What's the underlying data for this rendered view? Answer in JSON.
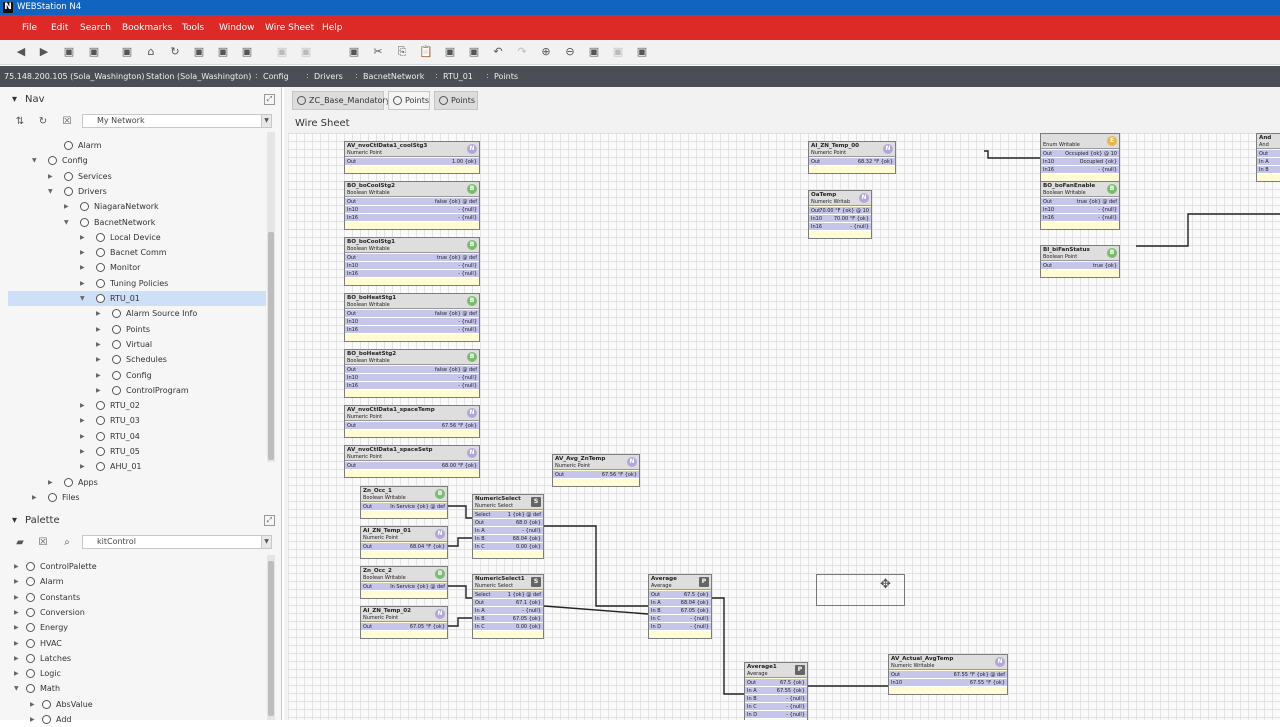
{
  "app": {
    "icon": "N",
    "title": "WEBStation N4"
  },
  "menu": [
    "File",
    "Edit",
    "Search",
    "Bookmarks",
    "Tools",
    "Window",
    "Wire Sheet",
    "Help"
  ],
  "toolbar": {
    "icons": [
      "back-icon",
      "forward-icon",
      "home-icon",
      "refresh-icon",
      "copy-icon",
      "cut-icon",
      "paste-icon",
      "undo-icon",
      "redo-icon",
      "zoom-in-icon",
      "zoom-out-icon"
    ]
  },
  "path": [
    "75.148.200.105 (Sola_Washington)",
    "Station (Sola_Washington)",
    "Config",
    "Drivers",
    "BacnetNetwork",
    "RTU_01",
    "Points"
  ],
  "nav": {
    "title": "Nav",
    "combo": "My Network",
    "tree": [
      {
        "label": "Alarm",
        "depth": 4,
        "twisty": ""
      },
      {
        "label": "Config",
        "depth": 3,
        "twisty": "down"
      },
      {
        "label": "Services",
        "depth": 4,
        "twisty": "right"
      },
      {
        "label": "Drivers",
        "depth": 4,
        "twisty": "down"
      },
      {
        "label": "NiagaraNetwork",
        "depth": 5,
        "twisty": "right"
      },
      {
        "label": "BacnetNetwork",
        "depth": 5,
        "twisty": "down"
      },
      {
        "label": "Local Device",
        "depth": 6,
        "twisty": "right"
      },
      {
        "label": "Bacnet Comm",
        "depth": 6,
        "twisty": "right"
      },
      {
        "label": "Monitor",
        "depth": 6,
        "twisty": "right"
      },
      {
        "label": "Tuning Policies",
        "depth": 6,
        "twisty": "right"
      },
      {
        "label": "RTU_01",
        "depth": 6,
        "twisty": "down",
        "selected": true
      },
      {
        "label": "Alarm Source Info",
        "depth": 7,
        "twisty": "right"
      },
      {
        "label": "Points",
        "depth": 7,
        "twisty": "right"
      },
      {
        "label": "Virtual",
        "depth": 7,
        "twisty": "right"
      },
      {
        "label": "Schedules",
        "depth": 7,
        "twisty": "right"
      },
      {
        "label": "Config",
        "depth": 7,
        "twisty": "right"
      },
      {
        "label": "ControlProgram",
        "depth": 7,
        "twisty": "right"
      },
      {
        "label": "RTU_02",
        "depth": 6,
        "twisty": "right"
      },
      {
        "label": "RTU_03",
        "depth": 6,
        "twisty": "right"
      },
      {
        "label": "RTU_04",
        "depth": 6,
        "twisty": "right"
      },
      {
        "label": "RTU_05",
        "depth": 6,
        "twisty": "right"
      },
      {
        "label": "AHU_01",
        "depth": 6,
        "twisty": "right"
      },
      {
        "label": "Apps",
        "depth": 4,
        "twisty": "right"
      },
      {
        "label": "Files",
        "depth": 3,
        "twisty": "right"
      }
    ]
  },
  "palette": {
    "title": "Palette",
    "combo": "kitControl",
    "items": [
      {
        "label": "ControlPalette",
        "twisty": "right",
        "depth": 0
      },
      {
        "label": "Alarm",
        "twisty": "right",
        "depth": 0
      },
      {
        "label": "Constants",
        "twisty": "right",
        "depth": 0
      },
      {
        "label": "Conversion",
        "twisty": "right",
        "depth": 0
      },
      {
        "label": "Energy",
        "twisty": "right",
        "depth": 0
      },
      {
        "label": "HVAC",
        "twisty": "right",
        "depth": 0
      },
      {
        "label": "Latches",
        "twisty": "right",
        "depth": 0
      },
      {
        "label": "Logic",
        "twisty": "right",
        "depth": 0
      },
      {
        "label": "Math",
        "twisty": "down",
        "depth": 0
      },
      {
        "label": "AbsValue",
        "twisty": "right",
        "depth": 1
      },
      {
        "label": "Add",
        "twisty": "right",
        "depth": 1
      }
    ]
  },
  "tabs": [
    "ZC_Base_Mandatory",
    "Points",
    "Points"
  ],
  "wiresheet_title": "Wire Sheet",
  "blocks": [
    {
      "name": "AV_nvoCtlData1_coolStg3",
      "type": "Numeric Point",
      "badge": "N",
      "rows": [
        [
          "Out",
          "1.00 {ok}"
        ]
      ]
    },
    {
      "name": "BO_boCoolStg2",
      "type": "Boolean Writable",
      "badge": "B",
      "rows": [
        [
          "Out",
          "false {ok} @ def"
        ],
        [
          "In10",
          "- {null}"
        ],
        [
          "In16",
          "- {null}"
        ]
      ]
    },
    {
      "name": "BO_boCoolStg1",
      "type": "Boolean Writable",
      "badge": "B",
      "rows": [
        [
          "Out",
          "true {ok} @ def"
        ],
        [
          "In10",
          "- {null}"
        ],
        [
          "In16",
          "- {null}"
        ]
      ]
    },
    {
      "name": "BO_boHeatStg1",
      "type": "Boolean Writable",
      "badge": "B",
      "rows": [
        [
          "Out",
          "false {ok} @ def"
        ],
        [
          "In10",
          "- {null}"
        ],
        [
          "In16",
          "- {null}"
        ]
      ]
    },
    {
      "name": "BO_boHeatStg2",
      "type": "Boolean Writable",
      "badge": "B",
      "rows": [
        [
          "Out",
          "false {ok} @ def"
        ],
        [
          "In10",
          "- {null}"
        ],
        [
          "In16",
          "- {null}"
        ]
      ]
    },
    {
      "name": "AV_nvoCtlData1_spaceTemp",
      "type": "Numeric Point",
      "badge": "N",
      "rows": [
        [
          "Out",
          "67.56 °F {ok}"
        ]
      ]
    },
    {
      "name": "AV_nvoCtlData1_spaceSetp",
      "type": "Numeric Point",
      "badge": "N",
      "rows": [
        [
          "Out",
          "68.00 °F {ok}"
        ]
      ]
    },
    {
      "name": "AV_Avg_ZnTemp",
      "type": "Numeric Point",
      "badge": "N",
      "rows": [
        [
          "Out",
          "67.56 °F {ok}"
        ]
      ]
    },
    {
      "name": "Zn_Occ_1",
      "type": "Boolean Writable",
      "badge": "B",
      "rows": [
        [
          "Out",
          "In Service {ok} @ def"
        ]
      ]
    },
    {
      "name": "AI_ZN_Temp_01",
      "type": "Numeric Point",
      "badge": "N",
      "rows": [
        [
          "Out",
          "68.04 °F {ok}"
        ]
      ]
    },
    {
      "name": "NumericSelect",
      "type": "Numeric Select",
      "badge": "S",
      "rows": [
        [
          "Select",
          "1 {ok} @ def"
        ],
        [
          "Out",
          "68.0 {ok}"
        ],
        [
          "In A",
          "- {null}"
        ],
        [
          "In B",
          "68.04 {ok}"
        ],
        [
          "In C",
          "0.00 {ok}"
        ]
      ]
    },
    {
      "name": "Zn_Occ_2",
      "type": "Boolean Writable",
      "badge": "B",
      "rows": [
        [
          "Out",
          "In Service {ok} @ def"
        ]
      ]
    },
    {
      "name": "AI_ZN_Temp_02",
      "type": "Numeric Point",
      "badge": "N",
      "rows": [
        [
          "Out",
          "67.05 °F {ok}"
        ]
      ]
    },
    {
      "name": "NumericSelect1",
      "type": "Numeric Select",
      "badge": "S",
      "rows": [
        [
          "Select",
          "1 {ok} @ def"
        ],
        [
          "Out",
          "67.1 {ok}"
        ],
        [
          "In A",
          "- {null}"
        ],
        [
          "In B",
          "67.05 {ok}"
        ],
        [
          "In C",
          "0.00 {ok}"
        ]
      ]
    },
    {
      "name": "Average",
      "type": "Average",
      "badge": "P",
      "rows": [
        [
          "Out",
          "67.5 {ok}"
        ],
        [
          "In A",
          "68.04 {ok}"
        ],
        [
          "In B",
          "67.05 {ok}"
        ],
        [
          "In C",
          "- {null}"
        ],
        [
          "In D",
          "- {null}"
        ]
      ]
    },
    {
      "name": "Average1",
      "type": "Average",
      "badge": "P",
      "rows": [
        [
          "Out",
          "67.5 {ok}"
        ],
        [
          "In A",
          "67.55 {ok}"
        ],
        [
          "In B",
          "- {null}"
        ],
        [
          "In C",
          "- {null}"
        ],
        [
          "In D",
          "- {null}"
        ]
      ]
    },
    {
      "name": "AV_Actual_AvgTemp",
      "type": "Numeric Writable",
      "badge": "N",
      "rows": [
        [
          "Out",
          "67.55 °F {ok} @ def"
        ],
        [
          "In10",
          "67.55 °F {ok}"
        ]
      ]
    },
    {
      "name": "AI_ZN_Temp_00",
      "type": "Numeric Point",
      "badge": "N",
      "rows": [
        [
          "Out",
          "68.32 °F {ok}"
        ]
      ]
    },
    {
      "name": "OaTemp",
      "type": "Numeric Writab",
      "badge": "N",
      "rows": [
        [
          "Out",
          "70.00 °F {ok} @ 10"
        ],
        [
          "In10",
          "70.00 °F {ok}"
        ],
        [
          "In16",
          "- {null}"
        ]
      ]
    },
    {
      "name": "",
      "type": "Enum Writable",
      "badge": "E",
      "rows": [
        [
          "Out",
          "Occupied {ok} @ 10"
        ],
        [
          "In10",
          "Occupied {ok}"
        ],
        [
          "In16",
          "- {null}"
        ]
      ]
    },
    {
      "name": "BO_boFanEnable",
      "type": "Boolean Writable",
      "badge": "B",
      "rows": [
        [
          "Out",
          "true {ok} @ def"
        ],
        [
          "In10",
          "- {null}"
        ],
        [
          "In16",
          "- {null}"
        ]
      ]
    },
    {
      "name": "BI_biFanStatus",
      "type": "Boolean Point",
      "badge": "B",
      "rows": [
        [
          "Out",
          "true {ok}"
        ]
      ]
    },
    {
      "name": "And",
      "type": "And",
      "badge": "",
      "rows": [
        [
          "Out",
          ""
        ],
        [
          "In A",
          ""
        ],
        [
          "In B",
          ""
        ]
      ]
    }
  ]
}
